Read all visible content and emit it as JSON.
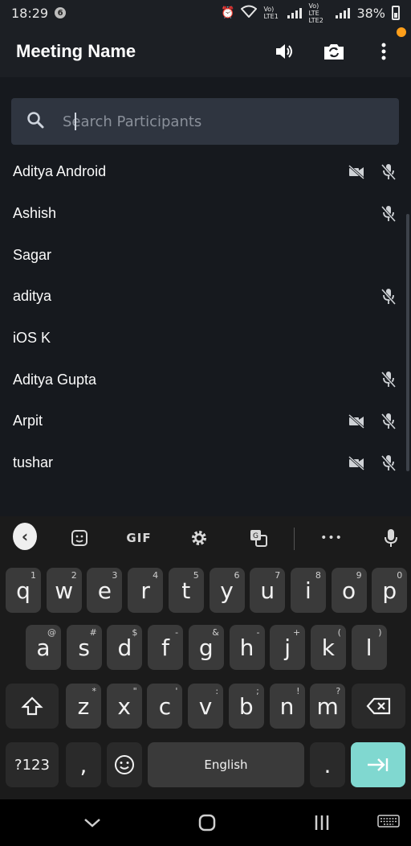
{
  "status_bar": {
    "time": "18:29",
    "notification_badge": "6",
    "sim1_label": "Vo) LTE1",
    "sim2_label": "Vo) LTE LTE2",
    "battery": "38%"
  },
  "app_bar": {
    "title": "Meeting Name",
    "icons": [
      "speaker-icon",
      "switch-camera-icon",
      "more-vert-icon"
    ]
  },
  "search": {
    "placeholder": "Search Participants"
  },
  "participants": [
    {
      "name": "Aditya Android",
      "video_off": true,
      "mic_off": true
    },
    {
      "name": "Ashish",
      "video_off": false,
      "mic_off": true
    },
    {
      "name": "Sagar",
      "video_off": false,
      "mic_off": false
    },
    {
      "name": "aditya",
      "video_off": false,
      "mic_off": true
    },
    {
      "name": "iOS K",
      "video_off": false,
      "mic_off": false
    },
    {
      "name": "Aditya Gupta",
      "video_off": false,
      "mic_off": true
    },
    {
      "name": "Arpit",
      "video_off": true,
      "mic_off": true
    },
    {
      "name": "tushar",
      "video_off": true,
      "mic_off": true
    }
  ],
  "keyboard": {
    "toolbar": {
      "gif": "GIF",
      "more": "•••"
    },
    "row1": [
      {
        "k": "q",
        "s": "1"
      },
      {
        "k": "w",
        "s": "2"
      },
      {
        "k": "e",
        "s": "3"
      },
      {
        "k": "r",
        "s": "4"
      },
      {
        "k": "t",
        "s": "5"
      },
      {
        "k": "y",
        "s": "6"
      },
      {
        "k": "u",
        "s": "7"
      },
      {
        "k": "i",
        "s": "8"
      },
      {
        "k": "o",
        "s": "9"
      },
      {
        "k": "p",
        "s": "0"
      }
    ],
    "row2": [
      {
        "k": "a",
        "s": "@"
      },
      {
        "k": "s",
        "s": "#"
      },
      {
        "k": "d",
        "s": "$"
      },
      {
        "k": "f",
        "s": "-"
      },
      {
        "k": "g",
        "s": "&"
      },
      {
        "k": "h",
        "s": "-"
      },
      {
        "k": "j",
        "s": "+"
      },
      {
        "k": "k",
        "s": "("
      },
      {
        "k": "l",
        "s": ")"
      }
    ],
    "row3": [
      {
        "k": "z",
        "s": "*"
      },
      {
        "k": "x",
        "s": "\""
      },
      {
        "k": "c",
        "s": "'"
      },
      {
        "k": "v",
        "s": ":"
      },
      {
        "k": "b",
        "s": ";"
      },
      {
        "k": "n",
        "s": "!"
      },
      {
        "k": "m",
        "s": "?"
      }
    ],
    "symbols_label": "?123",
    "comma": ",",
    "space_label": "English",
    "period": "."
  }
}
